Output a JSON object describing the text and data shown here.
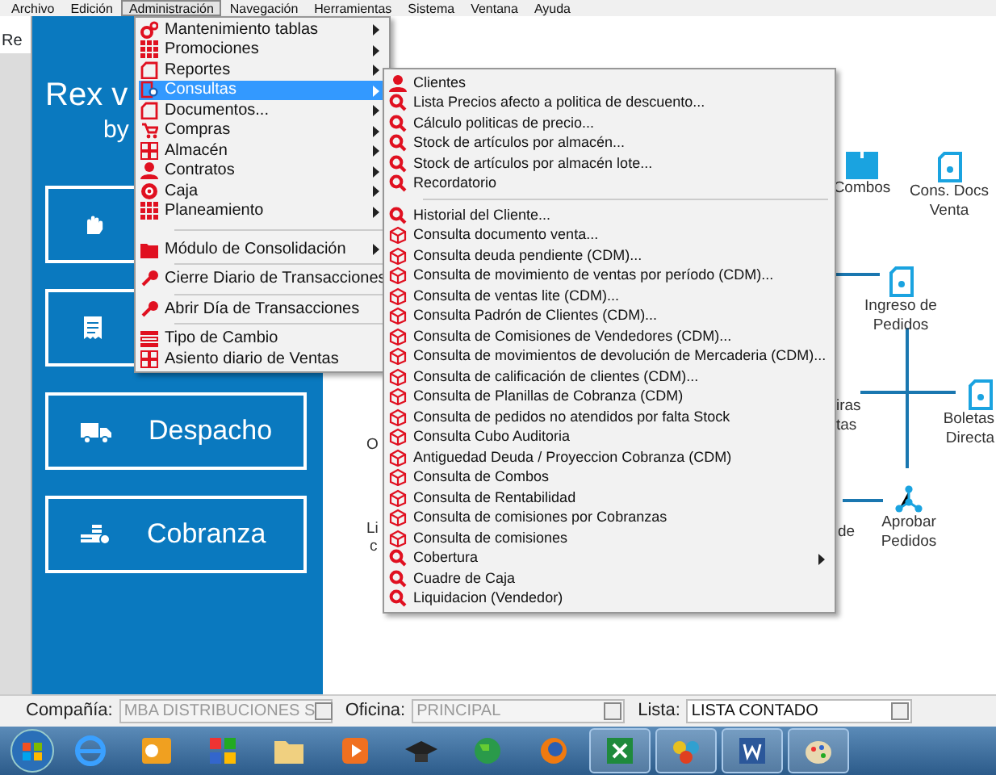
{
  "menu_bar": [
    {
      "label": "Archivo",
      "selected": false
    },
    {
      "label": "Edición",
      "selected": false
    },
    {
      "label": "Administración",
      "selected": true
    },
    {
      "label": "Navegación",
      "selected": false
    },
    {
      "label": "Herramientas",
      "selected": false
    },
    {
      "label": "Sistema",
      "selected": false
    },
    {
      "label": "Ventana",
      "selected": false
    },
    {
      "label": "Ayuda",
      "selected": false
    }
  ],
  "side_tab": "Re",
  "brand": {
    "title": "Rex v",
    "subtitle": "by"
  },
  "tiles": [
    {
      "kind": "hand"
    },
    {
      "kind": "receipt"
    },
    {
      "label": "Despacho",
      "kind": "truck"
    },
    {
      "label": "Cobranza",
      "kind": "coins"
    }
  ],
  "administracion_menu": [
    {
      "kind": "gears",
      "label": "Mantenimiento  tablas",
      "submenu": true,
      "selected": false
    },
    {
      "kind": "grid",
      "label": "Promociones",
      "submenu": true,
      "selected": false
    },
    {
      "kind": "document",
      "label": "Reportes",
      "submenu": true,
      "selected": false
    },
    {
      "kind": "search-document",
      "label": "Consultas",
      "submenu": true,
      "selected": true
    },
    {
      "kind": "document",
      "label": "Documentos...",
      "submenu": true,
      "selected": false
    },
    {
      "kind": "cart",
      "label": "Compras",
      "submenu": true,
      "selected": false
    },
    {
      "kind": "boxes",
      "label": "Almacén",
      "submenu": true,
      "selected": false
    },
    {
      "kind": "person",
      "label": "Contratos",
      "submenu": true,
      "selected": false
    },
    {
      "kind": "target",
      "label": "Caja",
      "submenu": true,
      "selected": false
    },
    {
      "kind": "grid",
      "label": "Planeamiento",
      "submenu": true,
      "selected": false
    },
    {
      "kind": "separator"
    },
    {
      "kind": "folder",
      "label": "Módulo de Consolidación",
      "submenu": true,
      "selected": false
    },
    {
      "kind": "separator"
    },
    {
      "kind": "key",
      "label": "Cierre Diario de Transacciones",
      "submenu": false,
      "selected": false
    },
    {
      "kind": "separator"
    },
    {
      "kind": "key",
      "label": "Abrir Día de Transacciones",
      "submenu": false,
      "selected": false
    },
    {
      "kind": "separator"
    },
    {
      "kind": "bars",
      "label": "Tipo de Cambio",
      "submenu": false,
      "selected": false
    },
    {
      "kind": "boxes",
      "label": "Asiento diario de Ventas",
      "submenu": false,
      "selected": false
    }
  ],
  "consultas_menu": [
    {
      "kind": "person",
      "label": "Clientes",
      "submenu": false
    },
    {
      "kind": "search",
      "label": "Lista Precios afecto a politica de descuento...",
      "submenu": false
    },
    {
      "kind": "search",
      "label": "Cálculo politicas de precio...",
      "submenu": false
    },
    {
      "kind": "search",
      "label": "Stock de artículos por almacén...",
      "submenu": false
    },
    {
      "kind": "search",
      "label": "Stock de artículos por almacén lote...",
      "submenu": false
    },
    {
      "kind": "search",
      "label": "Recordatorio",
      "submenu": false
    },
    {
      "kind": "separator"
    },
    {
      "kind": "search",
      "label": "Historial del Cliente...",
      "submenu": false
    },
    {
      "kind": "cube",
      "label": "Consulta documento venta...",
      "submenu": false
    },
    {
      "kind": "cube",
      "label": "Consulta deuda pendiente  (CDM)...",
      "submenu": false
    },
    {
      "kind": "cube",
      "label": "Consulta de movimiento de ventas por período (CDM)...",
      "submenu": false
    },
    {
      "kind": "cube",
      "label": "Consulta de ventas lite (CDM)...",
      "submenu": false
    },
    {
      "kind": "cube",
      "label": "Consulta Padrón de Clientes (CDM)...",
      "submenu": false
    },
    {
      "kind": "cube",
      "label": "Consulta de Comisiones de Vendedores (CDM)...",
      "submenu": false
    },
    {
      "kind": "cube",
      "label": "Consulta de movimientos de devolución de Mercaderia (CDM)...",
      "submenu": false
    },
    {
      "kind": "cube",
      "label": "Consulta de calificación de clientes (CDM)...",
      "submenu": false
    },
    {
      "kind": "cube",
      "label": "Consulta de Planillas de Cobranza (CDM)",
      "submenu": false
    },
    {
      "kind": "cube",
      "label": "Consulta de pedidos no atendidos por falta Stock",
      "submenu": false
    },
    {
      "kind": "cube",
      "label": "Consulta Cubo Auditoria",
      "submenu": false
    },
    {
      "kind": "cube",
      "label": "Antiguedad Deuda / Proyeccion Cobranza (CDM)",
      "submenu": false
    },
    {
      "kind": "cube",
      "label": "Consulta de Combos",
      "submenu": false
    },
    {
      "kind": "cube",
      "label": "Consulta de Rentabilidad",
      "submenu": false
    },
    {
      "kind": "cube",
      "label": "Consulta de comisiones por Cobranzas",
      "submenu": false
    },
    {
      "kind": "cube",
      "label": "Consulta de comisiones",
      "submenu": false
    },
    {
      "kind": "search",
      "label": "Cobertura",
      "submenu": true
    },
    {
      "kind": "search",
      "label": "Cuadre de Caja",
      "submenu": false
    },
    {
      "kind": "search",
      "label": "Liquidacion (Vendedor)",
      "submenu": false
    }
  ],
  "diagram_nodes": [
    {
      "lines": [
        "Combos"
      ],
      "kind": "box"
    },
    {
      "lines": [
        "Cons. Docs",
        "Venta"
      ],
      "kind": "document"
    },
    {
      "lines": [
        "Ingreso de",
        "Pedidos"
      ],
      "kind": "document"
    },
    {
      "lines": [
        "iras",
        "tas"
      ]
    },
    {
      "lines": [
        "Boletas",
        "Directa"
      ],
      "kind": "document"
    },
    {
      "lines": [
        "de"
      ]
    },
    {
      "lines": [
        "Aprobar",
        "Pedidos"
      ],
      "kind": "network"
    }
  ],
  "hidden_labels": [
    "O",
    "Li",
    "c"
  ],
  "status_bar": {
    "company_label": "Compañía:",
    "company": "MBA DISTRIBUCIONES S",
    "office_label": "Oficina:",
    "office": "PRINCIPAL",
    "list_label": "Lista:",
    "list": "LISTA CONTADO"
  },
  "taskbar": [
    {
      "kind": "browser",
      "running": false
    },
    {
      "kind": "mail",
      "running": false
    },
    {
      "kind": "puzzle",
      "running": false
    },
    {
      "kind": "folder",
      "running": false
    },
    {
      "kind": "media",
      "running": false
    },
    {
      "kind": "cap",
      "running": false
    },
    {
      "kind": "globe",
      "running": false
    },
    {
      "kind": "fox",
      "running": false
    },
    {
      "kind": "sheet",
      "running": true
    },
    {
      "kind": "flower",
      "running": true
    },
    {
      "kind": "word",
      "running": true
    },
    {
      "kind": "palette",
      "running": true
    }
  ]
}
